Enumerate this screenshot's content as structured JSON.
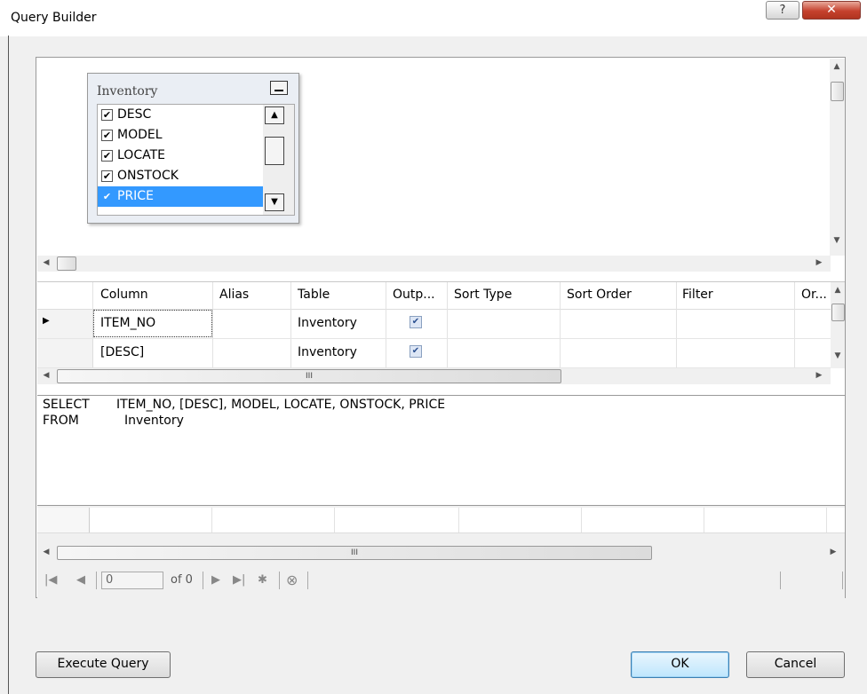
{
  "window": {
    "title": "Query Builder",
    "help_label": "?",
    "close_label": "✕"
  },
  "diagram": {
    "table_title": "Inventory",
    "columns": [
      {
        "label": "DESC",
        "checked": true,
        "selected": false
      },
      {
        "label": "MODEL",
        "checked": true,
        "selected": false
      },
      {
        "label": "LOCATE",
        "checked": true,
        "selected": false
      },
      {
        "label": "ONSTOCK",
        "checked": true,
        "selected": false
      },
      {
        "label": "PRICE",
        "checked": true,
        "selected": true
      }
    ]
  },
  "grid": {
    "headers": [
      "Column",
      "Alias",
      "Table",
      "Outp...",
      "Sort Type",
      "Sort Order",
      "Filter",
      "Or..."
    ],
    "rows": [
      {
        "column": "ITEM_NO",
        "alias": "",
        "table": "Inventory",
        "output": true,
        "current": true
      },
      {
        "column": "[DESC]",
        "alias": "",
        "table": "Inventory",
        "output": true,
        "current": false
      }
    ],
    "hscroll_grip": "III"
  },
  "sql": {
    "line1_keyword": "SELECT",
    "line1_value": "ITEM_NO, [DESC], MODEL, LOCATE, ONSTOCK, PRICE",
    "line2_keyword": "FROM",
    "line2_value": "Inventory"
  },
  "results": {
    "hscroll_grip": "III",
    "position": "0",
    "of_label": "of 0"
  },
  "buttons": {
    "execute": "Execute Query",
    "ok": "OK",
    "cancel": "Cancel"
  }
}
